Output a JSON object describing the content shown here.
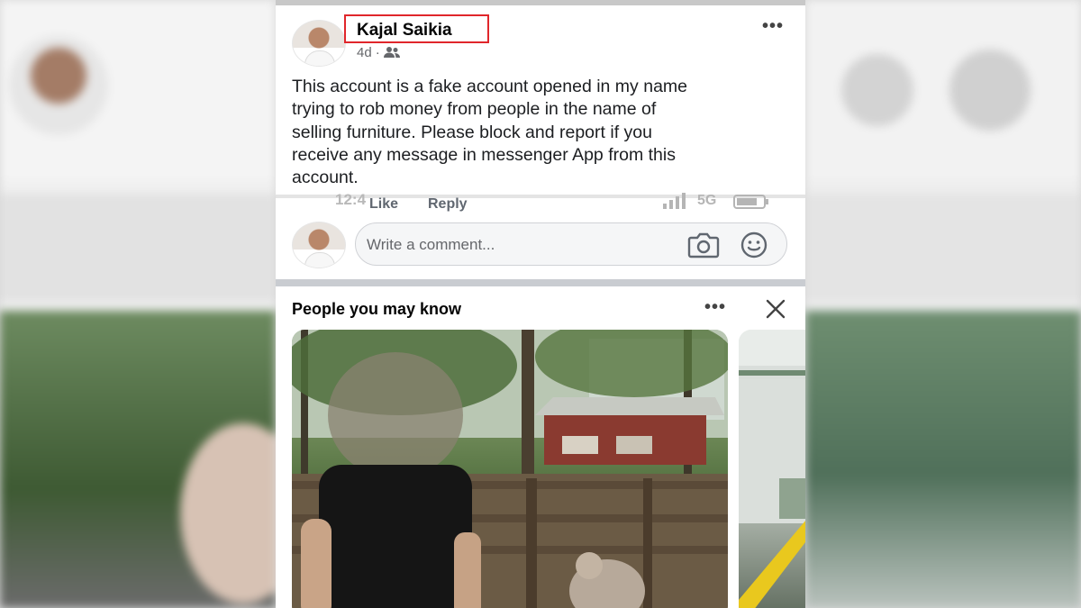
{
  "post": {
    "author": "Kajal Saikia",
    "time": "4d",
    "separator": "·",
    "audience_icon": "friends-icon",
    "more_label": "•••",
    "text_lines": [
      "This account is a fake account opened in my name",
      "trying to rob money from people in the name of",
      "selling furniture. Please block and report if you",
      "receive  any message in messenger App from this",
      "account."
    ]
  },
  "overlap": {
    "clock": "12:4",
    "like": "Like",
    "reply": "Reply",
    "network": "5G"
  },
  "composer": {
    "placeholder": "Write a comment...",
    "camera_icon": "camera-icon",
    "emoji_icon": "smile-icon"
  },
  "pymk": {
    "title": "People you may know",
    "more_label": "•••",
    "close_icon": "close-icon"
  },
  "colors": {
    "highlight_box": "#e0262b",
    "text": "#1c1e21",
    "meta": "#65676b"
  }
}
